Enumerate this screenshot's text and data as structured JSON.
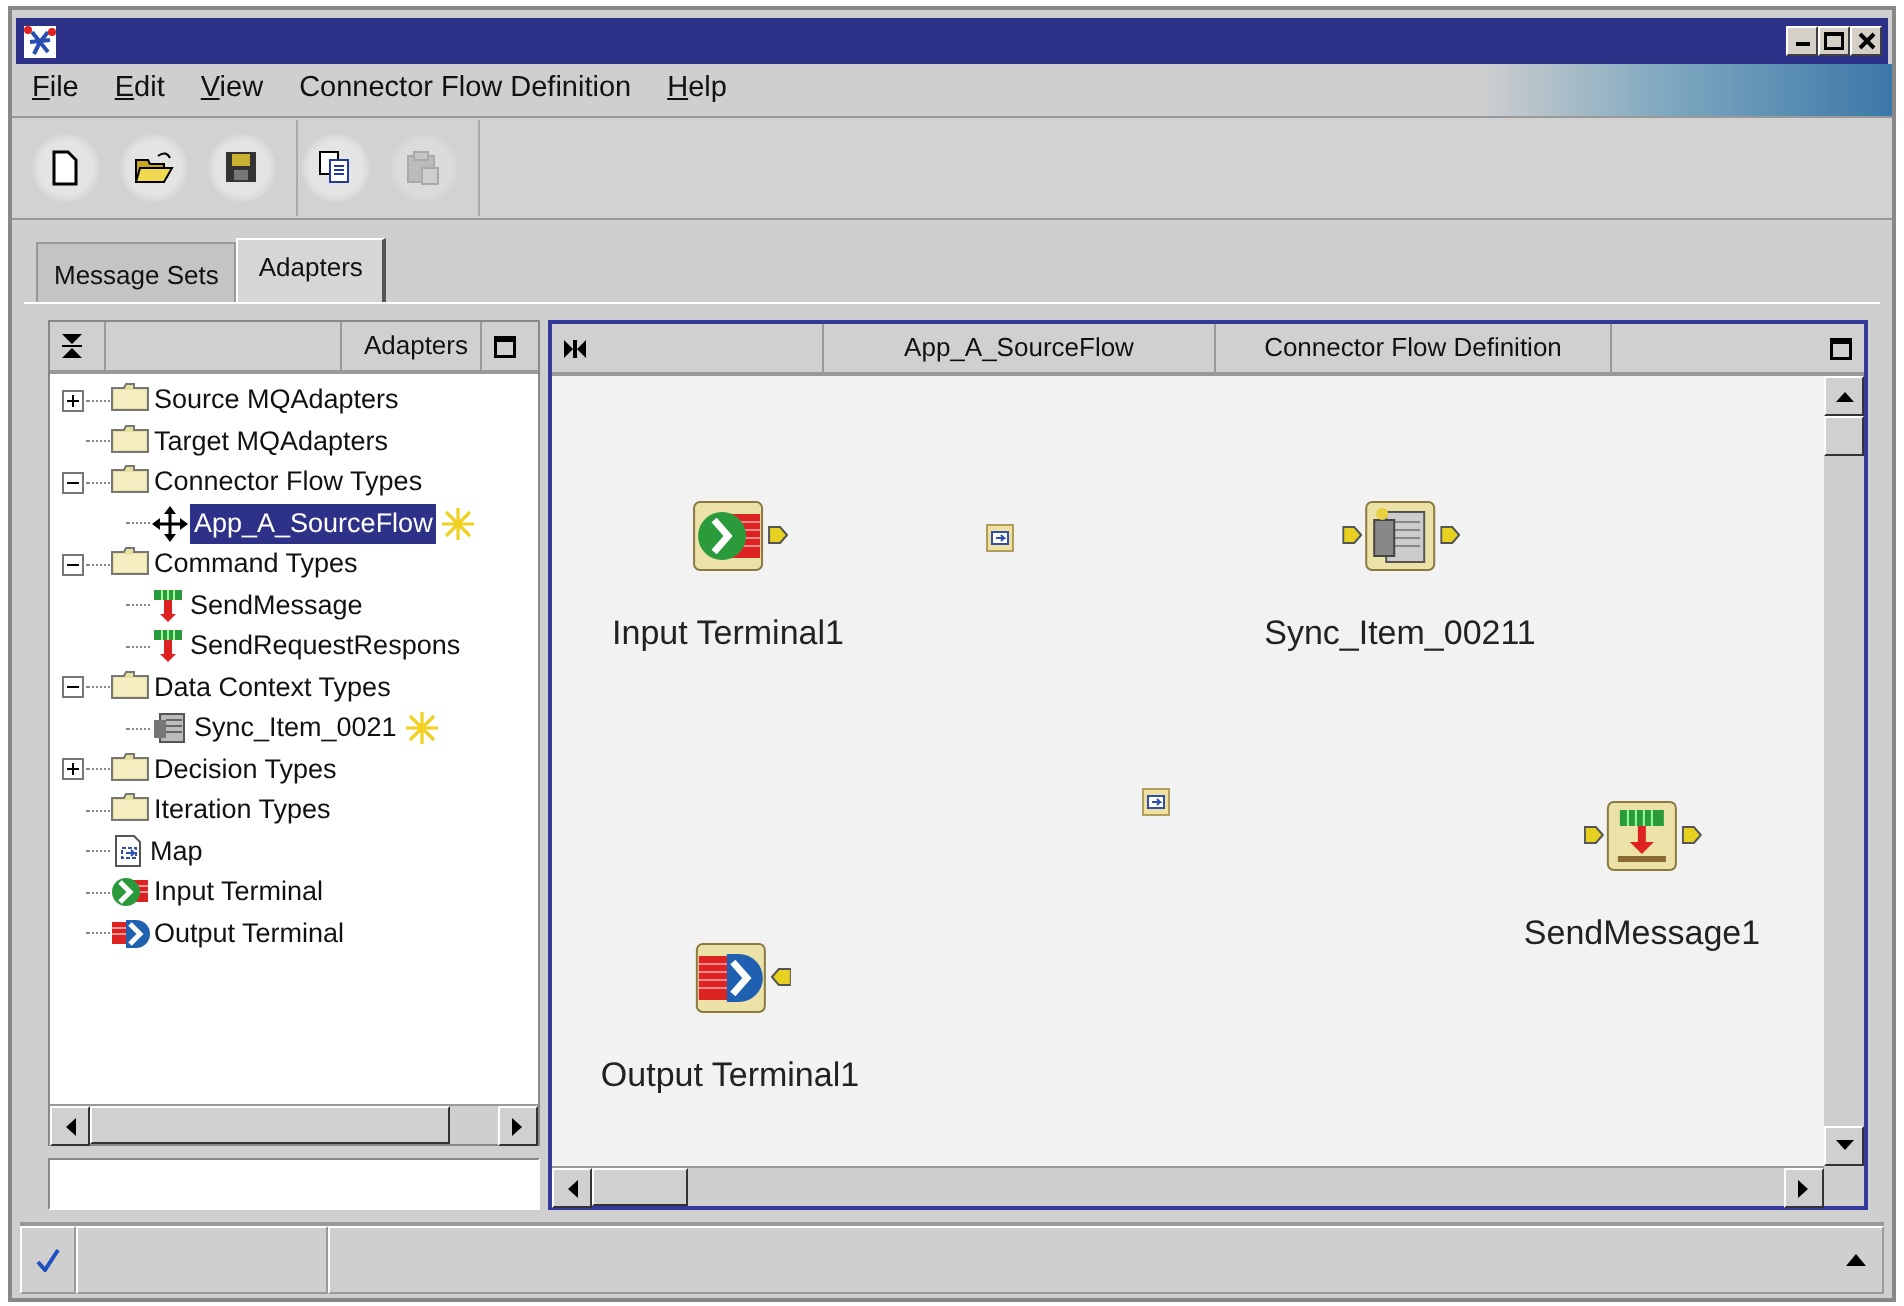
{
  "menu": [
    {
      "label": "File",
      "mnemonic": true
    },
    {
      "label": "Edit",
      "mnemonic": true
    },
    {
      "label": "View",
      "mnemonic": true
    },
    {
      "label": "Connector Flow Definition",
      "mnemonic": false
    },
    {
      "label": "Help",
      "mnemonic": true
    }
  ],
  "toolbar_groups": [
    [
      {
        "kind": "new",
        "disabled": false
      },
      {
        "kind": "open",
        "disabled": false
      },
      {
        "kind": "save",
        "disabled": false
      }
    ],
    [
      {
        "kind": "copy",
        "disabled": false
      },
      {
        "kind": "paste",
        "disabled": true
      }
    ]
  ],
  "tabs": [
    {
      "label": "Message Sets",
      "selected": false
    },
    {
      "label": "Adapters",
      "selected": true
    }
  ],
  "tree_panel": {
    "title": "Adapters",
    "nodes": [
      {
        "label": "Source MQAdapters",
        "kind": "folder",
        "expanded": false,
        "selected": false,
        "starred": false
      },
      {
        "label": "Target MQAdapters",
        "kind": "folder",
        "selected": false,
        "starred": false
      },
      {
        "label": "Connector Flow Types",
        "kind": "folder",
        "expanded": true,
        "selected": false,
        "starred": false,
        "children": [
          {
            "label": "App_A_SourceFlow",
            "kind": "flow",
            "selected": true,
            "starred": true
          }
        ]
      },
      {
        "label": "Command Types",
        "kind": "folder",
        "expanded": true,
        "selected": false,
        "starred": false,
        "children": [
          {
            "label": "SendMessage",
            "kind": "command",
            "selected": false,
            "starred": false
          },
          {
            "label": "SendRequestRespons",
            "kind": "command",
            "selected": false,
            "starred": false
          }
        ]
      },
      {
        "label": "Data Context Types",
        "kind": "folder",
        "expanded": true,
        "selected": false,
        "starred": false,
        "children": [
          {
            "label": "Sync_Item_0021",
            "kind": "data",
            "selected": false,
            "starred": true
          }
        ]
      },
      {
        "label": "Decision Types",
        "kind": "folder",
        "expanded": false,
        "selected": false,
        "starred": false
      },
      {
        "label": "Iteration Types",
        "kind": "folder",
        "selected": false,
        "starred": false
      },
      {
        "label": "Map",
        "kind": "map",
        "selected": false,
        "starred": false
      },
      {
        "label": "Input Terminal",
        "kind": "input",
        "selected": false,
        "starred": false
      },
      {
        "label": "Output Terminal",
        "kind": "output",
        "selected": false,
        "starred": false
      }
    ]
  },
  "editor": {
    "title": "App_A_SourceFlow",
    "subtitle": "Connector Flow Definition",
    "nodes": [
      {
        "kind": "input",
        "label": "Input Terminal1"
      },
      {
        "kind": "map"
      },
      {
        "kind": "data",
        "label": "Sync_Item_00211"
      },
      {
        "kind": "map"
      },
      {
        "kind": "command",
        "label": "SendMessage1"
      },
      {
        "kind": "output",
        "label": "Output Terminal1"
      }
    ]
  }
}
